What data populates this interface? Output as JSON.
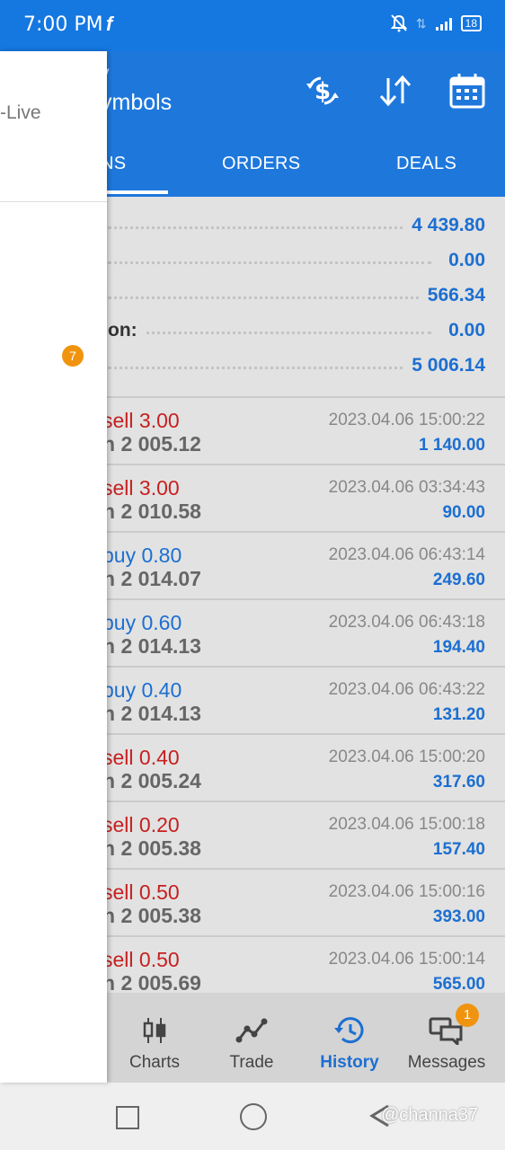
{
  "status_bar": {
    "time": "7:00 PM",
    "fb_glyph": "f",
    "battery": "18"
  },
  "app_bar": {
    "subtitle": "y",
    "title": "ymbols"
  },
  "tabs": [
    {
      "label": "NS",
      "active": true
    },
    {
      "label": "ORDERS"
    },
    {
      "label": "DEALS"
    }
  ],
  "summary": [
    {
      "label": "",
      "value": "4 439.80"
    },
    {
      "label": "",
      "value": "0.00"
    },
    {
      "label": "",
      "value": "566.34"
    },
    {
      "label": "on:",
      "value": "0.00"
    },
    {
      "label": "",
      "value": "5 006.14"
    }
  ],
  "deals": [
    {
      "type": "sell 3.00",
      "side": "sell",
      "price": "n  2 005.12",
      "time": "2023.04.06 15:00:22",
      "profit": "1 140.00"
    },
    {
      "type": "sell 3.00",
      "side": "sell",
      "price": "n  2 010.58",
      "time": "2023.04.06 03:34:43",
      "profit": "90.00"
    },
    {
      "type": "buy 0.80",
      "side": "buy",
      "price": "n  2 014.07",
      "time": "2023.04.06 06:43:14",
      "profit": "249.60"
    },
    {
      "type": "buy 0.60",
      "side": "buy",
      "price": "n  2 014.13",
      "time": "2023.04.06 06:43:18",
      "profit": "194.40"
    },
    {
      "type": "buy 0.40",
      "side": "buy",
      "price": "n  2 014.13",
      "time": "2023.04.06 06:43:22",
      "profit": "131.20"
    },
    {
      "type": "sell 0.40",
      "side": "sell",
      "price": "n  2 005.24",
      "time": "2023.04.06 15:00:20",
      "profit": "317.60"
    },
    {
      "type": "sell 0.20",
      "side": "sell",
      "price": "n  2 005.38",
      "time": "2023.04.06 15:00:18",
      "profit": "157.40"
    },
    {
      "type": "sell 0.50",
      "side": "sell",
      "price": "n  2 005.38",
      "time": "2023.04.06 15:00:16",
      "profit": "393.00"
    },
    {
      "type": "sell 0.50",
      "side": "sell",
      "price": "n  2 005.69",
      "time": "2023.04.06 15:00:14",
      "profit": "565.00"
    }
  ],
  "bottom_nav": [
    {
      "label": "Charts",
      "icon": "candlestick-icon"
    },
    {
      "label": "Trade",
      "icon": "trend-line-icon"
    },
    {
      "label": "History",
      "icon": "history-icon",
      "active": true
    },
    {
      "label": "Messages",
      "icon": "chat-icon",
      "badge": "1"
    }
  ],
  "drawer": {
    "account": "-Live",
    "badge": "7"
  },
  "watermark": "@channa37",
  "colors": {
    "primary": "#1e78dc",
    "sell": "#c71f1f",
    "buy": "#1c6fd1",
    "badge": "#f0940f"
  }
}
